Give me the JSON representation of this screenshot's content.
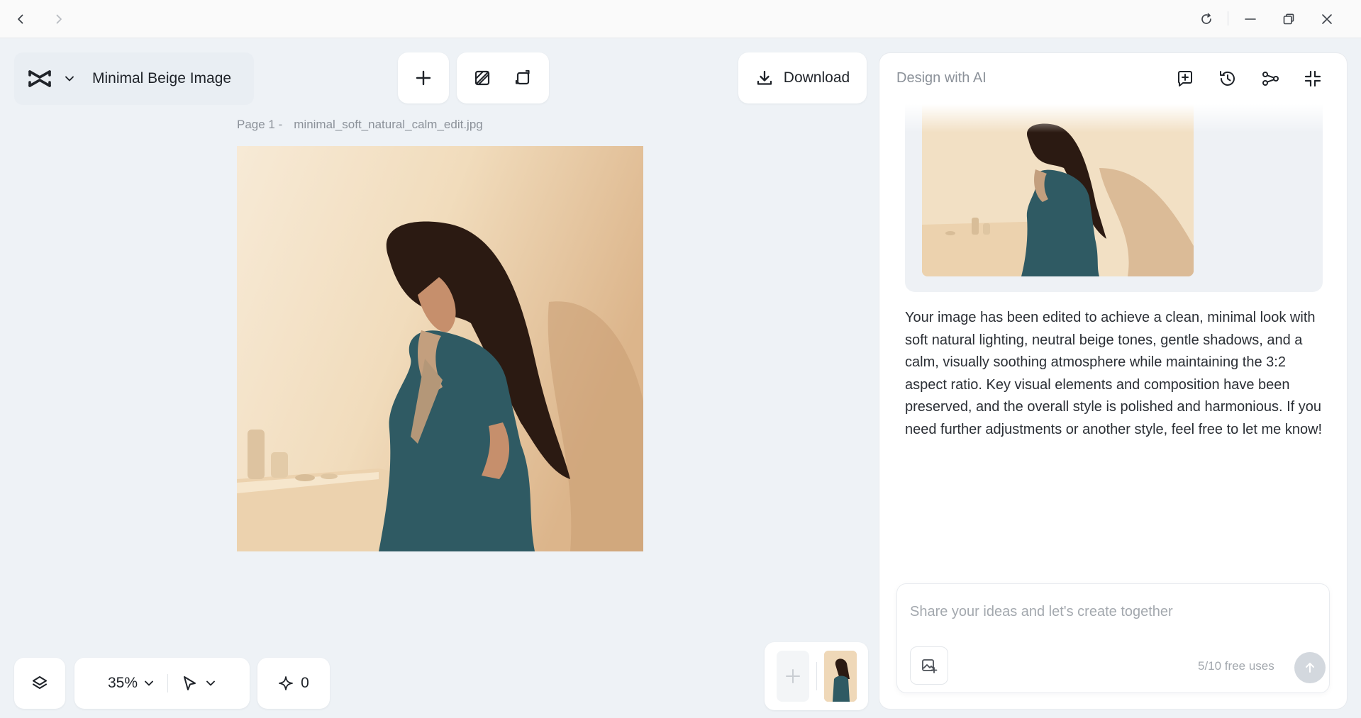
{
  "window": {
    "back_icon": "chevron-left-icon",
    "forward_icon": "chevron-right-icon",
    "reload_icon": "reload-icon",
    "minimize_icon": "minimize-icon",
    "restore_icon": "restore-icon",
    "close_icon": "close-icon"
  },
  "project": {
    "title": "Minimal Beige Image",
    "logo_icon": "capcut-logo-icon"
  },
  "toolbar": {
    "download_label": "Download"
  },
  "canvas": {
    "page_prefix": "Page 1 -",
    "file_name": "minimal_soft_natural_calm_edit.jpg"
  },
  "bottom": {
    "zoom": "35%",
    "credits": "0"
  },
  "panel": {
    "title": "Design with AI",
    "message": "Your image has been edited to achieve a clean, minimal look with soft natural lighting, neutral beige tones, gentle shadows, and a calm, visually soothing atmosphere while maintaining the 3:2 aspect ratio. Key visual elements and composition have been preserved, and the overall style is polished and harmonious. If you need further adjustments or another style, feel free to let me know!",
    "input_placeholder": "Share your ideas and let's create together",
    "input_value": "",
    "free_uses": "5/10 free uses"
  },
  "colors": {
    "background": "#eef2f6",
    "panel": "#ffffff",
    "beige": "#f0dab9",
    "dress": "#2f5a63",
    "hair": "#2b1a12"
  }
}
